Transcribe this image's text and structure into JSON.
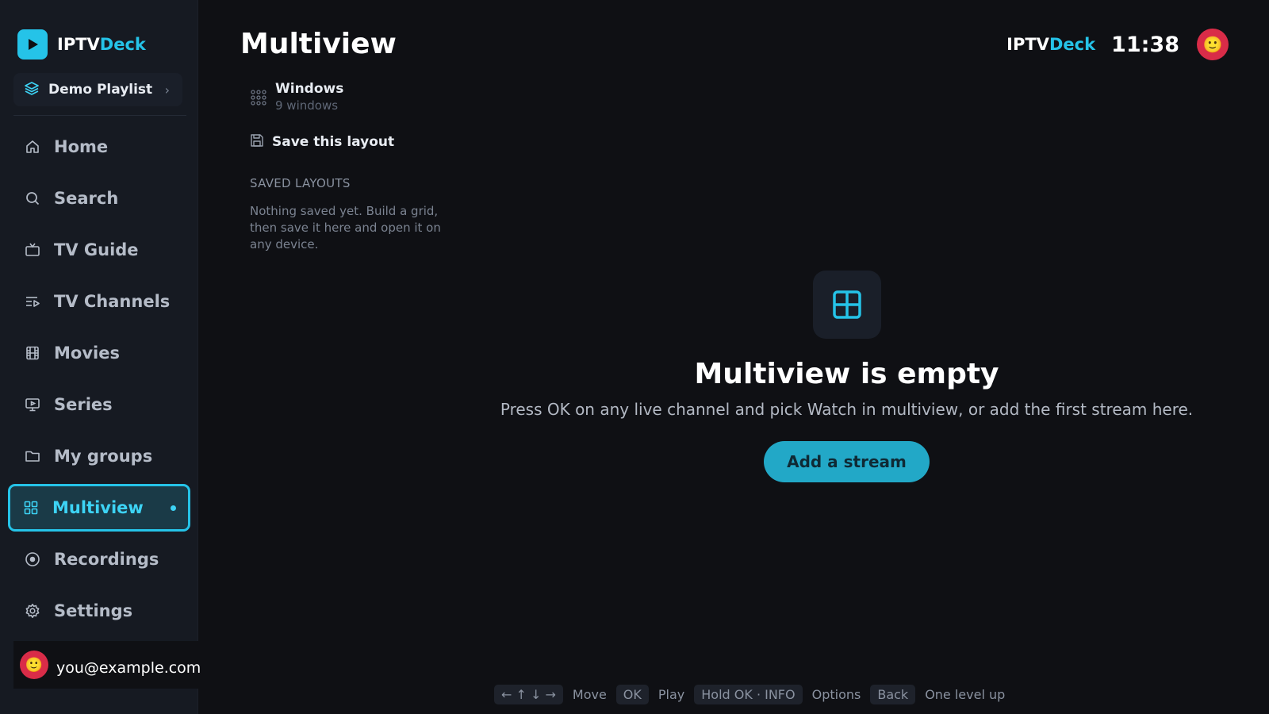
{
  "app": {
    "brand_prefix": "IPTV",
    "brand_suffix": "Deck",
    "accent_color": "#25c3e8"
  },
  "sidebar": {
    "playlist": {
      "label": "Demo Playlist",
      "icon": "layers-icon"
    },
    "items": [
      {
        "label": "Home",
        "icon": "home-icon",
        "active": false
      },
      {
        "label": "Search",
        "icon": "search-icon",
        "active": false
      },
      {
        "label": "TV Guide",
        "icon": "tv-icon",
        "active": false
      },
      {
        "label": "TV Channels",
        "icon": "channel-list-icon",
        "active": false
      },
      {
        "label": "Movies",
        "icon": "film-icon",
        "active": false
      },
      {
        "label": "Series",
        "icon": "series-icon",
        "active": false
      },
      {
        "label": "My groups",
        "icon": "folder-icon",
        "active": false
      },
      {
        "label": "Multiview",
        "icon": "grid-icon",
        "active": true
      },
      {
        "label": "Recordings",
        "icon": "record-icon",
        "active": false
      },
      {
        "label": "Settings",
        "icon": "gear-icon",
        "active": false
      }
    ],
    "user": {
      "email": "you@example.com",
      "avatar": "🙂"
    }
  },
  "header": {
    "title": "Multiview",
    "clock": "11:38",
    "avatar": "🙂"
  },
  "panel": {
    "windows_label": "Windows",
    "windows_count": "9 windows",
    "save_label": "Save this layout",
    "saved_heading": "SAVED LAYOUTS",
    "saved_empty": "Nothing saved yet. Build a grid, then save it here and open it on any device."
  },
  "empty_state": {
    "title": "Multiview is empty",
    "description": "Press OK on any live channel and pick Watch in multiview, or add the first stream here.",
    "button": "Add a stream"
  },
  "hints": {
    "arrows_key": "← ↑ ↓ →",
    "arrows_action": "Move",
    "ok_key": "OK",
    "ok_action": "Play",
    "hold_key": "Hold OK · INFO",
    "hold_action": "Options",
    "back_key": "Back",
    "back_action": "One level up"
  }
}
